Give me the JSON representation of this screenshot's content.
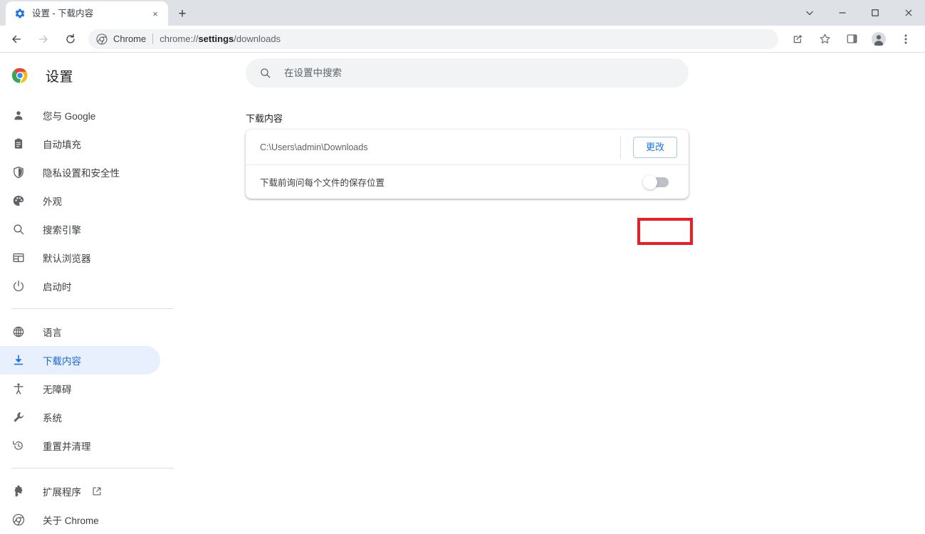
{
  "window": {
    "controls": [
      {
        "name": "tab-search",
        "glyph": "chevron-down"
      },
      {
        "name": "minimize",
        "glyph": "minimize"
      },
      {
        "name": "maximize",
        "glyph": "maximize"
      },
      {
        "name": "close",
        "glyph": "close"
      }
    ]
  },
  "tab": {
    "title": "设置 - 下载内容",
    "favicon": "settings-gear-icon",
    "close_label": "×",
    "newtab_label": "+"
  },
  "toolbar": {
    "back": "back-arrow-icon",
    "forward": "forward-arrow-icon",
    "reload": "reload-icon",
    "omnibox": {
      "icon": "chrome-logo-icon",
      "label": "Chrome",
      "url_prefix": "chrome://",
      "url_bold": "settings",
      "url_suffix": "/downloads"
    },
    "actions": [
      {
        "name": "share-icon"
      },
      {
        "name": "bookmark-star-icon"
      },
      {
        "name": "side-panel-icon"
      },
      {
        "name": "profile-avatar"
      },
      {
        "name": "more-menu-icon"
      }
    ]
  },
  "sidebar": {
    "title": "设置",
    "logo": "chrome-logo-icon",
    "groups": [
      {
        "items": [
          {
            "label": "您与 Google",
            "icon": "person-icon",
            "selected": false
          },
          {
            "label": "自动填充",
            "icon": "clipboard-icon",
            "selected": false
          },
          {
            "label": "隐私设置和安全性",
            "icon": "shield-icon",
            "selected": false
          },
          {
            "label": "外观",
            "icon": "palette-icon",
            "selected": false
          },
          {
            "label": "搜索引擎",
            "icon": "search-icon",
            "selected": false
          },
          {
            "label": "默认浏览器",
            "icon": "browser-window-icon",
            "selected": false
          },
          {
            "label": "启动时",
            "icon": "power-icon",
            "selected": false
          }
        ]
      },
      {
        "items": [
          {
            "label": "语言",
            "icon": "globe-icon",
            "selected": false
          },
          {
            "label": "下载内容",
            "icon": "download-icon",
            "selected": true
          },
          {
            "label": "无障碍",
            "icon": "accessibility-icon",
            "selected": false
          },
          {
            "label": "系统",
            "icon": "wrench-icon",
            "selected": false
          },
          {
            "label": "重置并清理",
            "icon": "history-restore-icon",
            "selected": false
          }
        ]
      },
      {
        "items": [
          {
            "label": "扩展程序",
            "icon": "puzzle-icon",
            "selected": false,
            "external": true
          },
          {
            "label": "关于 Chrome",
            "icon": "chrome-outline-icon",
            "selected": false
          }
        ]
      }
    ]
  },
  "main": {
    "search": {
      "placeholder": "在设置中搜索",
      "value": "",
      "icon": "search-icon"
    },
    "section_title": "下载内容",
    "location_row": {
      "path": "C:\\Users\\admin\\Downloads",
      "change_button": "更改"
    },
    "ask_row": {
      "label": "下载前询问每个文件的保存位置",
      "toggle_state": "off"
    }
  },
  "annotation": {
    "shape": "rectangle",
    "color": "#ee1c25",
    "target": "ask-where-to-save-toggle"
  },
  "colors": {
    "accent": "#1a73e8",
    "selected_bg": "#e8f0fe",
    "tabstrip_bg": "#dee1e6",
    "omnibox_bg": "#f1f3f4",
    "annotation": "#ee1c25"
  }
}
